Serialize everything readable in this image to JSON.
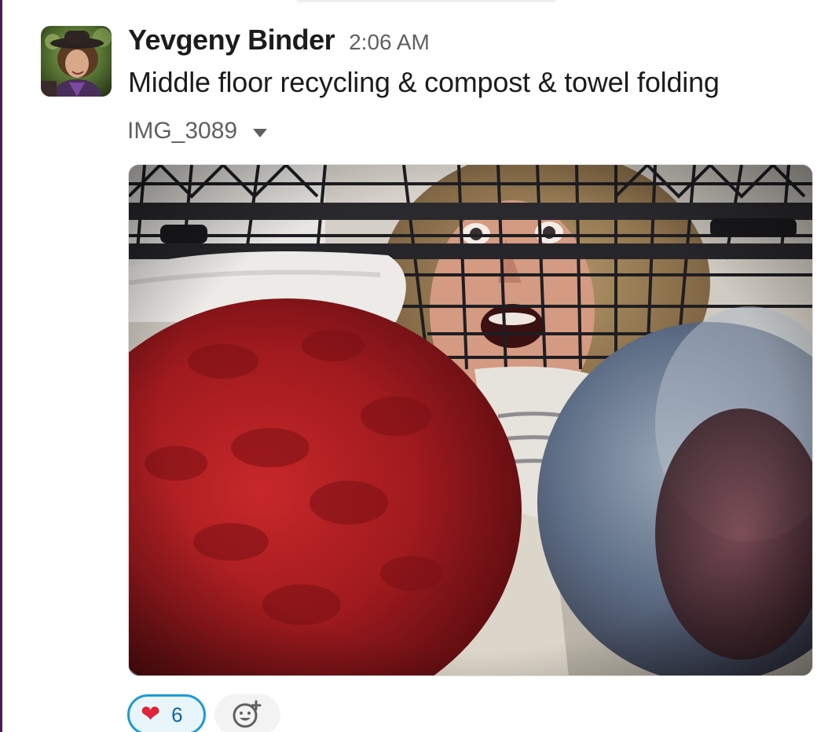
{
  "message": {
    "author": "Yevgeny Binder",
    "timestamp": "2:06 AM",
    "text": "Middle floor recycling & compost & towel folding",
    "avatar_icon": "user-avatar-photo"
  },
  "attachment": {
    "filename": "IMG_3089",
    "toggle_icon": "caret-down-icon",
    "image_description_icon": "photo-laundry-basket"
  },
  "reactions": [
    {
      "emoji": "❤",
      "emoji_name": "heart",
      "count": "6",
      "selected": true
    }
  ],
  "add_reaction": {
    "icon": "add-reaction-icon"
  },
  "colors": {
    "accent_blue": "#1d9bd1",
    "count_blue": "#1264a3",
    "rail_purple": "#4a1d4e",
    "text_primary": "#1d1c1d",
    "text_secondary": "#616061"
  }
}
